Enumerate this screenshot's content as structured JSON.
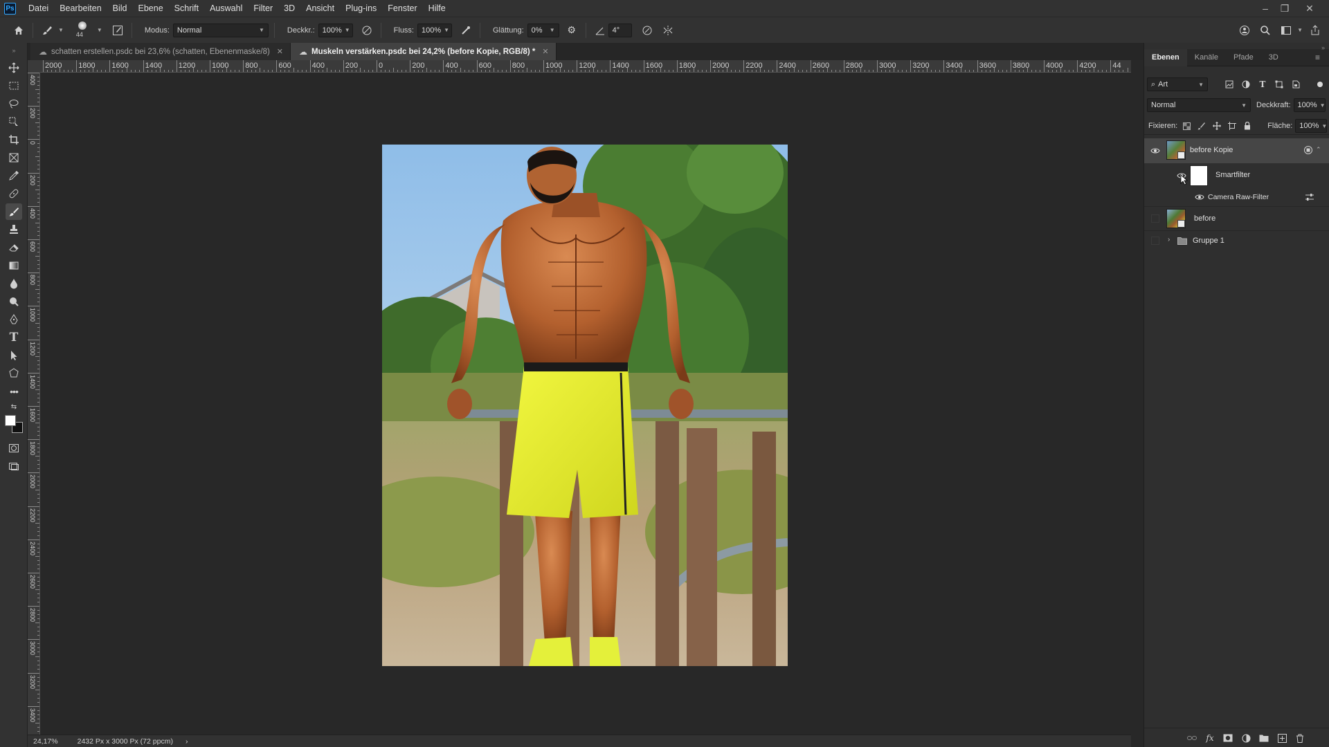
{
  "menubar": {
    "logo": "Ps",
    "items": [
      "Datei",
      "Bearbeiten",
      "Bild",
      "Ebene",
      "Schrift",
      "Auswahl",
      "Filter",
      "3D",
      "Ansicht",
      "Plug-ins",
      "Fenster",
      "Hilfe"
    ],
    "window_controls": {
      "minimize": "–",
      "restore": "❐",
      "close": "✕"
    }
  },
  "options": {
    "brush_size": "44",
    "modus_label": "Modus:",
    "modus_value": "Normal",
    "deckkraft_label": "Deckkr.:",
    "deckkraft_value": "100%",
    "fluss_label": "Fluss:",
    "fluss_value": "100%",
    "glaettung_label": "Glättung:",
    "glaettung_value": "0%",
    "angle_value": "4°"
  },
  "tabs": [
    {
      "label": "schatten erstellen.psdc bei 23,6% (schatten, Ebenenmaske/8)",
      "active": false
    },
    {
      "label": "Muskeln verstärken.psdc bei 24,2% (before Kopie, RGB/8) *",
      "active": true
    }
  ],
  "ruler": {
    "horizontal": [
      "2000",
      "1800",
      "1600",
      "1400",
      "1200",
      "1000",
      "800",
      "600",
      "400",
      "200",
      "0",
      "200",
      "400",
      "600",
      "800",
      "1000",
      "1200",
      "1400",
      "1600",
      "1800",
      "2000",
      "2200",
      "2400",
      "2600",
      "2800",
      "3000",
      "3200",
      "3400",
      "3600",
      "3800",
      "4000",
      "4200",
      "44"
    ],
    "vertical": [
      "400",
      "200",
      "0",
      "200",
      "400",
      "600",
      "800",
      "1000",
      "1200",
      "1400",
      "1600",
      "1800",
      "2000",
      "2200",
      "2400",
      "2600",
      "2800",
      "3000",
      "3200",
      "3400"
    ]
  },
  "status": {
    "zoom": "24,17%",
    "doc_info": "2432 Px x 3000 Px (72 ppcm)",
    "arrow": "›"
  },
  "panel": {
    "tabs": [
      "Ebenen",
      "Kanäle",
      "Pfade",
      "3D"
    ],
    "active_tab": "Ebenen",
    "filter_kind": "Art",
    "blend_mode": "Normal",
    "deckkraft_label": "Deckkraft:",
    "deckkraft_value": "100%",
    "fixieren_label": "Fixieren:",
    "flaeche_label": "Fläche:",
    "flaeche_value": "100%",
    "layers": {
      "before_kopie": "before Kopie",
      "smartfilter": "Smartfilter",
      "camera_raw": "Camera Raw-Filter",
      "before": "before",
      "gruppe": "Gruppe 1"
    },
    "bottom_icons": [
      "link-icon",
      "fx-icon",
      "mask-icon",
      "adjustment-icon",
      "folder-icon",
      "new-layer-icon",
      "trash-icon"
    ]
  },
  "colors": {
    "accent": "#31a8ff",
    "app_bg": "#282828",
    "panel_bg": "#323232",
    "shorts": "#e8f034"
  }
}
